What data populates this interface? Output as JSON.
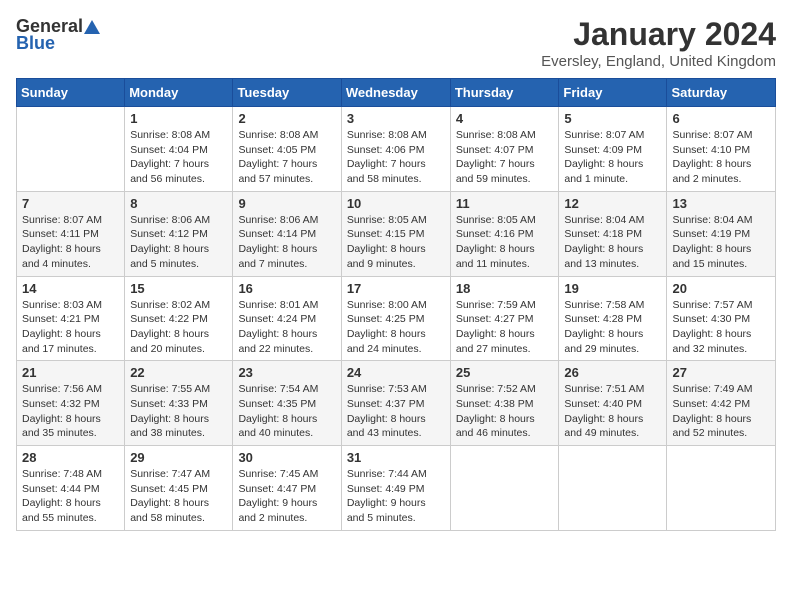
{
  "logo": {
    "general": "General",
    "blue": "Blue"
  },
  "title": "January 2024",
  "location": "Eversley, England, United Kingdom",
  "days_of_week": [
    "Sunday",
    "Monday",
    "Tuesday",
    "Wednesday",
    "Thursday",
    "Friday",
    "Saturday"
  ],
  "weeks": [
    [
      {
        "num": "",
        "sunrise": "",
        "sunset": "",
        "daylight": ""
      },
      {
        "num": "1",
        "sunrise": "Sunrise: 8:08 AM",
        "sunset": "Sunset: 4:04 PM",
        "daylight": "Daylight: 7 hours and 56 minutes."
      },
      {
        "num": "2",
        "sunrise": "Sunrise: 8:08 AM",
        "sunset": "Sunset: 4:05 PM",
        "daylight": "Daylight: 7 hours and 57 minutes."
      },
      {
        "num": "3",
        "sunrise": "Sunrise: 8:08 AM",
        "sunset": "Sunset: 4:06 PM",
        "daylight": "Daylight: 7 hours and 58 minutes."
      },
      {
        "num": "4",
        "sunrise": "Sunrise: 8:08 AM",
        "sunset": "Sunset: 4:07 PM",
        "daylight": "Daylight: 7 hours and 59 minutes."
      },
      {
        "num": "5",
        "sunrise": "Sunrise: 8:07 AM",
        "sunset": "Sunset: 4:09 PM",
        "daylight": "Daylight: 8 hours and 1 minute."
      },
      {
        "num": "6",
        "sunrise": "Sunrise: 8:07 AM",
        "sunset": "Sunset: 4:10 PM",
        "daylight": "Daylight: 8 hours and 2 minutes."
      }
    ],
    [
      {
        "num": "7",
        "sunrise": "Sunrise: 8:07 AM",
        "sunset": "Sunset: 4:11 PM",
        "daylight": "Daylight: 8 hours and 4 minutes."
      },
      {
        "num": "8",
        "sunrise": "Sunrise: 8:06 AM",
        "sunset": "Sunset: 4:12 PM",
        "daylight": "Daylight: 8 hours and 5 minutes."
      },
      {
        "num": "9",
        "sunrise": "Sunrise: 8:06 AM",
        "sunset": "Sunset: 4:14 PM",
        "daylight": "Daylight: 8 hours and 7 minutes."
      },
      {
        "num": "10",
        "sunrise": "Sunrise: 8:05 AM",
        "sunset": "Sunset: 4:15 PM",
        "daylight": "Daylight: 8 hours and 9 minutes."
      },
      {
        "num": "11",
        "sunrise": "Sunrise: 8:05 AM",
        "sunset": "Sunset: 4:16 PM",
        "daylight": "Daylight: 8 hours and 11 minutes."
      },
      {
        "num": "12",
        "sunrise": "Sunrise: 8:04 AM",
        "sunset": "Sunset: 4:18 PM",
        "daylight": "Daylight: 8 hours and 13 minutes."
      },
      {
        "num": "13",
        "sunrise": "Sunrise: 8:04 AM",
        "sunset": "Sunset: 4:19 PM",
        "daylight": "Daylight: 8 hours and 15 minutes."
      }
    ],
    [
      {
        "num": "14",
        "sunrise": "Sunrise: 8:03 AM",
        "sunset": "Sunset: 4:21 PM",
        "daylight": "Daylight: 8 hours and 17 minutes."
      },
      {
        "num": "15",
        "sunrise": "Sunrise: 8:02 AM",
        "sunset": "Sunset: 4:22 PM",
        "daylight": "Daylight: 8 hours and 20 minutes."
      },
      {
        "num": "16",
        "sunrise": "Sunrise: 8:01 AM",
        "sunset": "Sunset: 4:24 PM",
        "daylight": "Daylight: 8 hours and 22 minutes."
      },
      {
        "num": "17",
        "sunrise": "Sunrise: 8:00 AM",
        "sunset": "Sunset: 4:25 PM",
        "daylight": "Daylight: 8 hours and 24 minutes."
      },
      {
        "num": "18",
        "sunrise": "Sunrise: 7:59 AM",
        "sunset": "Sunset: 4:27 PM",
        "daylight": "Daylight: 8 hours and 27 minutes."
      },
      {
        "num": "19",
        "sunrise": "Sunrise: 7:58 AM",
        "sunset": "Sunset: 4:28 PM",
        "daylight": "Daylight: 8 hours and 29 minutes."
      },
      {
        "num": "20",
        "sunrise": "Sunrise: 7:57 AM",
        "sunset": "Sunset: 4:30 PM",
        "daylight": "Daylight: 8 hours and 32 minutes."
      }
    ],
    [
      {
        "num": "21",
        "sunrise": "Sunrise: 7:56 AM",
        "sunset": "Sunset: 4:32 PM",
        "daylight": "Daylight: 8 hours and 35 minutes."
      },
      {
        "num": "22",
        "sunrise": "Sunrise: 7:55 AM",
        "sunset": "Sunset: 4:33 PM",
        "daylight": "Daylight: 8 hours and 38 minutes."
      },
      {
        "num": "23",
        "sunrise": "Sunrise: 7:54 AM",
        "sunset": "Sunset: 4:35 PM",
        "daylight": "Daylight: 8 hours and 40 minutes."
      },
      {
        "num": "24",
        "sunrise": "Sunrise: 7:53 AM",
        "sunset": "Sunset: 4:37 PM",
        "daylight": "Daylight: 8 hours and 43 minutes."
      },
      {
        "num": "25",
        "sunrise": "Sunrise: 7:52 AM",
        "sunset": "Sunset: 4:38 PM",
        "daylight": "Daylight: 8 hours and 46 minutes."
      },
      {
        "num": "26",
        "sunrise": "Sunrise: 7:51 AM",
        "sunset": "Sunset: 4:40 PM",
        "daylight": "Daylight: 8 hours and 49 minutes."
      },
      {
        "num": "27",
        "sunrise": "Sunrise: 7:49 AM",
        "sunset": "Sunset: 4:42 PM",
        "daylight": "Daylight: 8 hours and 52 minutes."
      }
    ],
    [
      {
        "num": "28",
        "sunrise": "Sunrise: 7:48 AM",
        "sunset": "Sunset: 4:44 PM",
        "daylight": "Daylight: 8 hours and 55 minutes."
      },
      {
        "num": "29",
        "sunrise": "Sunrise: 7:47 AM",
        "sunset": "Sunset: 4:45 PM",
        "daylight": "Daylight: 8 hours and 58 minutes."
      },
      {
        "num": "30",
        "sunrise": "Sunrise: 7:45 AM",
        "sunset": "Sunset: 4:47 PM",
        "daylight": "Daylight: 9 hours and 2 minutes."
      },
      {
        "num": "31",
        "sunrise": "Sunrise: 7:44 AM",
        "sunset": "Sunset: 4:49 PM",
        "daylight": "Daylight: 9 hours and 5 minutes."
      },
      {
        "num": "",
        "sunrise": "",
        "sunset": "",
        "daylight": ""
      },
      {
        "num": "",
        "sunrise": "",
        "sunset": "",
        "daylight": ""
      },
      {
        "num": "",
        "sunrise": "",
        "sunset": "",
        "daylight": ""
      }
    ]
  ]
}
